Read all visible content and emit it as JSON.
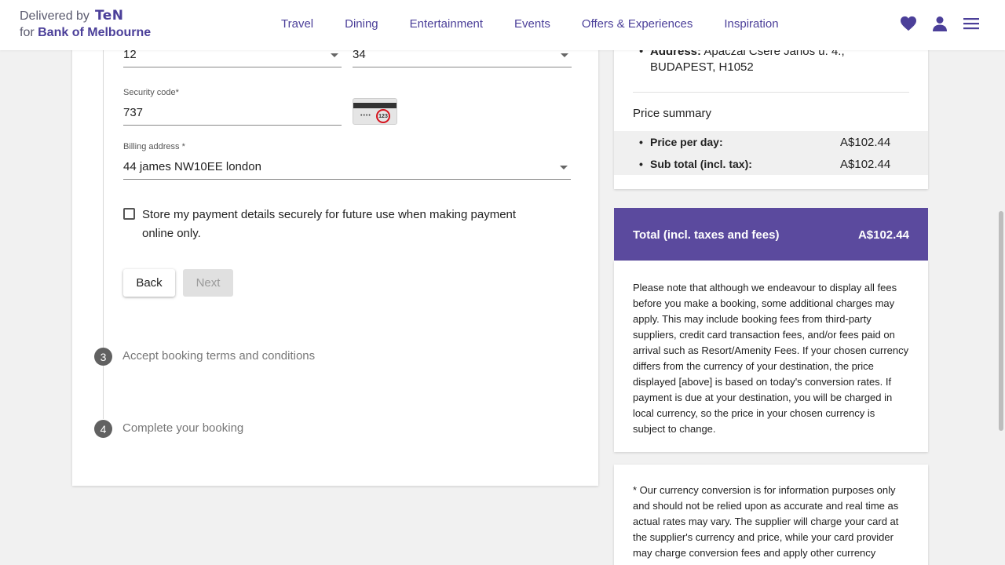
{
  "header": {
    "delivered_by": "Delivered by",
    "ten_logo": "TeN",
    "for_text": "for",
    "bank_name": "Bank of Melbourne",
    "nav": [
      "Travel",
      "Dining",
      "Entertainment",
      "Events",
      "Offers & Experiences",
      "Inspiration"
    ],
    "icons": [
      "heart-icon",
      "user-icon",
      "menu-icon"
    ]
  },
  "payment": {
    "expiry_month": "12",
    "expiry_year": "34",
    "security_label": "Security code*",
    "security_value": "737",
    "card_cvv_dots": "••••",
    "card_cvv_digits": "123",
    "billing_label": "Billing address *",
    "billing_value": "44 james NW10EE london",
    "store_details_text": "Store my payment details securely for future use when making payment online only.",
    "back_label": "Back",
    "next_label": "Next"
  },
  "steps": [
    {
      "num": "3",
      "title": "Accept booking terms and conditions"
    },
    {
      "num": "4",
      "title": "Complete your booking"
    }
  ],
  "summary": {
    "address_label": "Address:",
    "address_value": "Apáczai Csere János u. 4., BUDAPEST, H1052",
    "price_summary_title": "Price summary",
    "rows": [
      {
        "label": "Price per day:",
        "amount": "A$102.44"
      },
      {
        "label": "Sub total (incl. tax):",
        "amount": "A$102.44"
      }
    ],
    "total_label": "Total (incl. taxes and fees)",
    "total_amount": "A$102.44",
    "fees_note": "Please note that although we endeavour to display all fees before you make a booking, some additional charges may apply. This may include booking fees from third-party suppliers, credit card transaction fees, and/or fees paid on arrival such as Resort/Amenity Fees. If your chosen currency differs from the currency of your destination, the price displayed [above] is based on today's conversion rates. If payment is due at your destination, you will be charged in local currency, so the price in your chosen currency is subject to change.",
    "currency_note": "* Our currency conversion is for information purposes only and should not be relied upon as accurate and real time as actual rates may vary. The supplier will charge your card at the supplier's currency and price, while your card provider may charge conversion fees and apply other currency"
  },
  "colors": {
    "brand": "#5b4a9e",
    "nav_text": "#4b3f99"
  }
}
